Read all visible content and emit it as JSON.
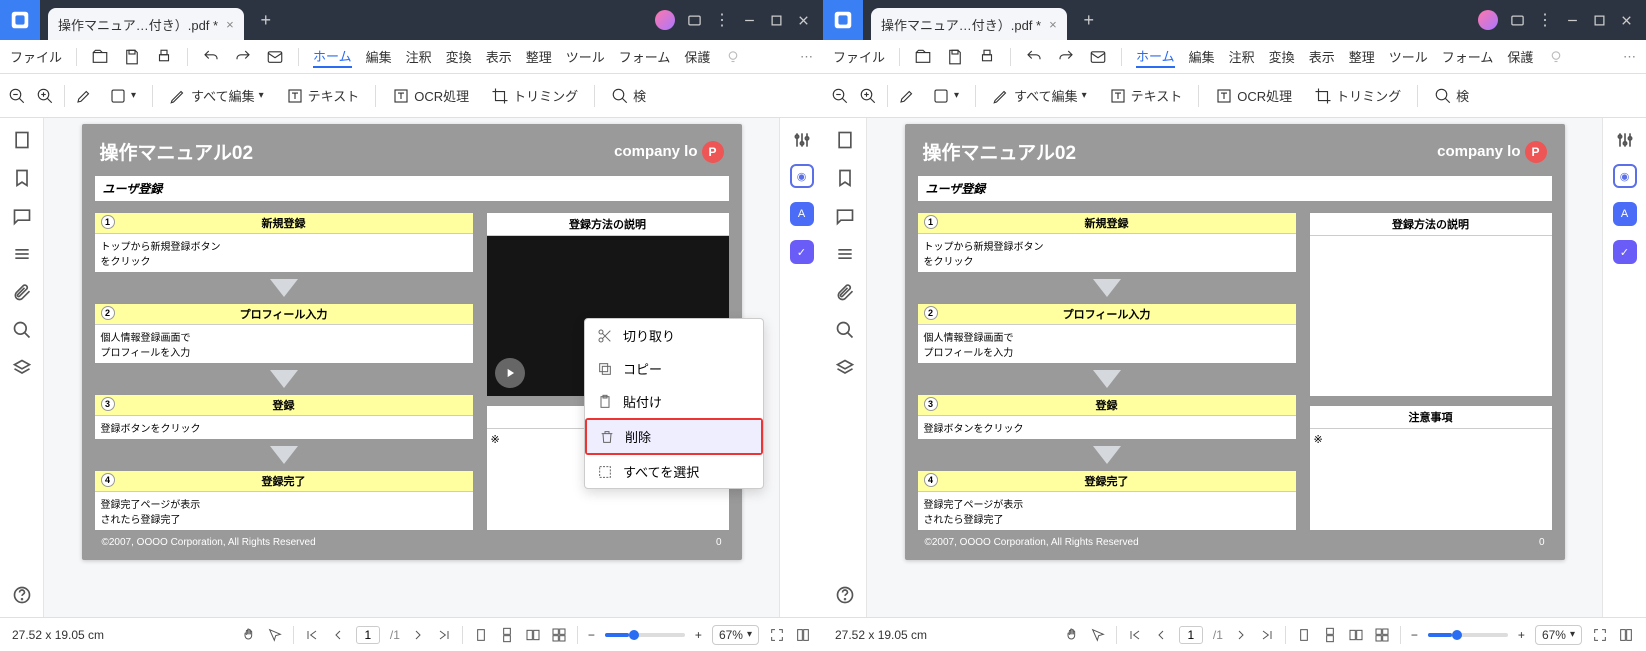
{
  "tab_title": "操作マニュア…付き）.pdf *",
  "menu": {
    "file": "ファイル",
    "items": [
      "ホーム",
      "編集",
      "注釈",
      "変換",
      "表示",
      "整理",
      "ツール",
      "フォーム",
      "保護"
    ],
    "active_index": 0
  },
  "toolbar": {
    "edit_all": "すべて編集",
    "text": "テキスト",
    "ocr": "OCR処理",
    "trim": "トリミング",
    "search": "検"
  },
  "page": {
    "title": "操作マニュアル02",
    "company": "company lo",
    "user_reg": "ユーザ登録",
    "steps": [
      {
        "n": "1",
        "title": "新規登録",
        "body": "トップから新規登録ボタン\nをクリック"
      },
      {
        "n": "2",
        "title": "プロフィール入力",
        "body": "個人情報登録画面で\nプロフィールを入力"
      },
      {
        "n": "3",
        "title": "登録",
        "body": "登録ボタンをクリック"
      },
      {
        "n": "4",
        "title": "登録完了",
        "body": "登録完了ページが表示\nされたら登録完了"
      }
    ],
    "reg_method_title": "登録方法の説明",
    "notes_title": "注意事項",
    "notes_body": "※",
    "footer": "©2007, OOOO Corporation, All Rights Reserved",
    "footer_page": "0"
  },
  "context_menu": {
    "cut": "切り取り",
    "copy": "コピー",
    "paste": "貼付け",
    "delete": "削除",
    "select_all": "すべてを選択"
  },
  "status": {
    "dimensions": "27.52 x 19.05 cm",
    "page_current": "1",
    "page_total": "/1",
    "zoom": "67%"
  }
}
